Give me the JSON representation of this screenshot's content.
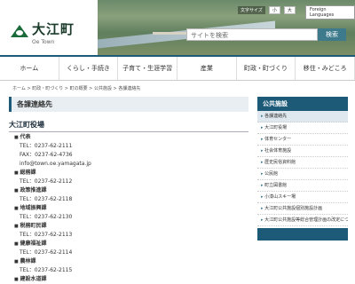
{
  "header": {
    "logo_text": "大江町",
    "logo_sub": "Oe Town",
    "font_size_label": "文字サイズ",
    "font_small": "小",
    "font_large": "大",
    "lang_label": "Foreign Languages",
    "search_placeholder": "サイトを検索",
    "search_button": "検索"
  },
  "nav": {
    "items": [
      "ホーム",
      "くらし・手続き",
      "子育て・生涯学習",
      "産業",
      "町政・町づくり",
      "移住・みどころ"
    ]
  },
  "breadcrumb": "ホーム > 町政・町づくり > 町の概要 > 公共施設 > 各課連絡先",
  "main": {
    "title": "各課連絡先",
    "section": "大江町役場",
    "entries": [
      {
        "dept": "代表",
        "tel": "TEL：0237-62-2111",
        "fax": "FAX：0237-62-4736",
        "email": "info@town.oe.yamagata.jp"
      },
      {
        "dept": "総務課",
        "tel": "TEL：0237-62-2112"
      },
      {
        "dept": "政策推進課",
        "tel": "TEL：0237-62-2118"
      },
      {
        "dept": "地域振興課",
        "tel": "TEL：0237-62-2130"
      },
      {
        "dept": "税務町民課",
        "tel": "TEL：0237-62-2113"
      },
      {
        "dept": "健康福祉課",
        "tel": "TEL：0237-62-2114"
      },
      {
        "dept": "農林課",
        "tel": "TEL：0237-62-2115"
      },
      {
        "dept": "建設水道課",
        "tel": ""
      }
    ]
  },
  "sidebar": {
    "title": "公共施設",
    "items": [
      "各課連絡先",
      "大江町役場",
      "体育センター",
      "社会体育施設",
      "歴史民俗資料館",
      "公民館",
      "町立図書館",
      "小漆山スキー場",
      "大江町公共施設個別施設計画",
      "大江町公共施設等総合管理計画の改定について"
    ]
  }
}
